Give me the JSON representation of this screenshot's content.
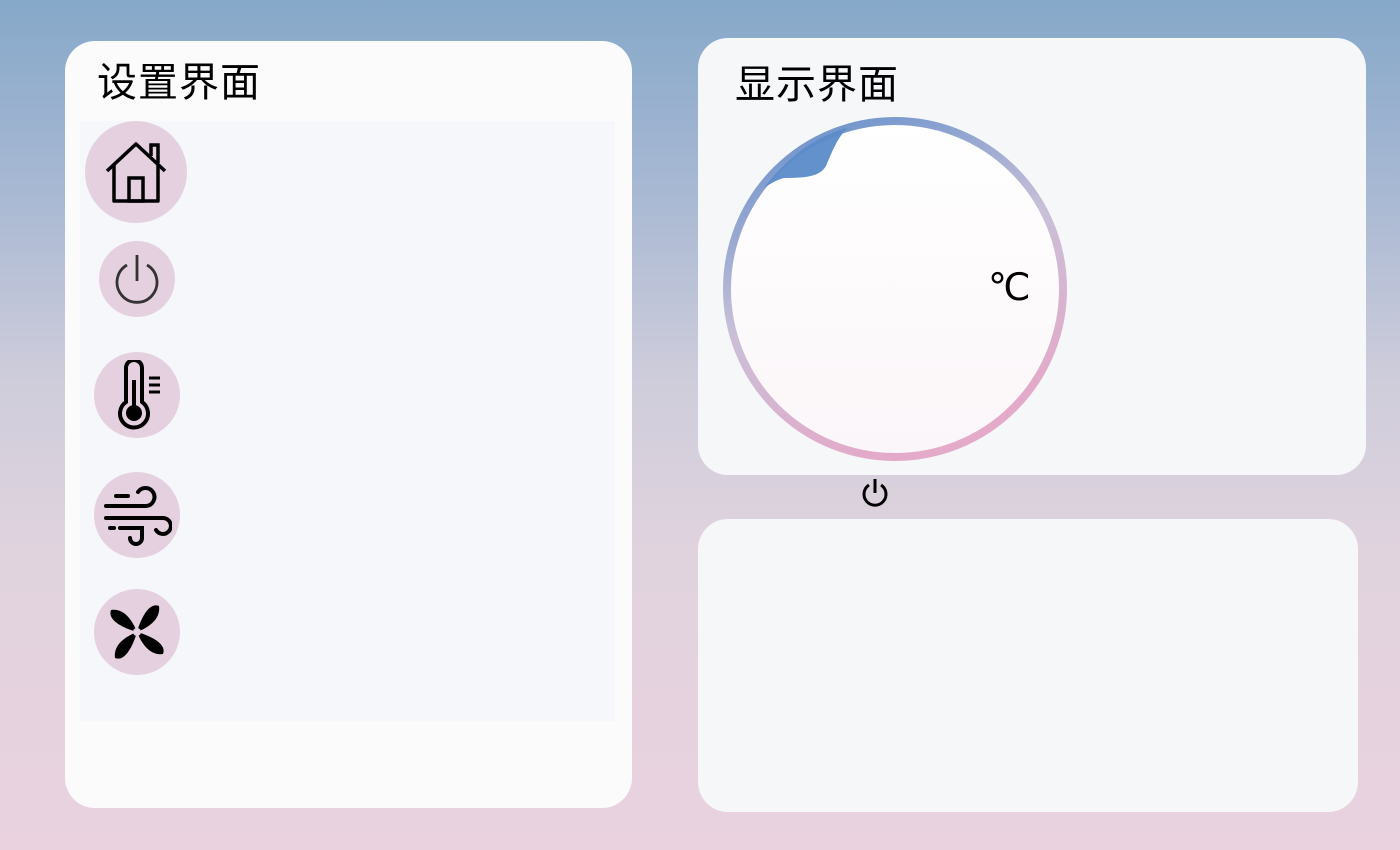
{
  "settings_panel": {
    "title": "设置界面",
    "nav": [
      {
        "icon": "home-icon"
      },
      {
        "icon": "power-icon"
      },
      {
        "icon": "thermometer-icon"
      },
      {
        "icon": "wind-icon"
      },
      {
        "icon": "fan-icon"
      }
    ]
  },
  "display_panel": {
    "title": "显示界面",
    "dial": {
      "unit": "℃",
      "power_icon": "power-icon",
      "gradient_colors": [
        "#5b8bc9",
        "#e3aac9"
      ]
    }
  },
  "colors": {
    "panel_bg": "#f6f7f9",
    "nav_button_bg": "#e5d0df",
    "dial_blue": "#5b8bc9",
    "dial_pink": "#e3aac9"
  }
}
